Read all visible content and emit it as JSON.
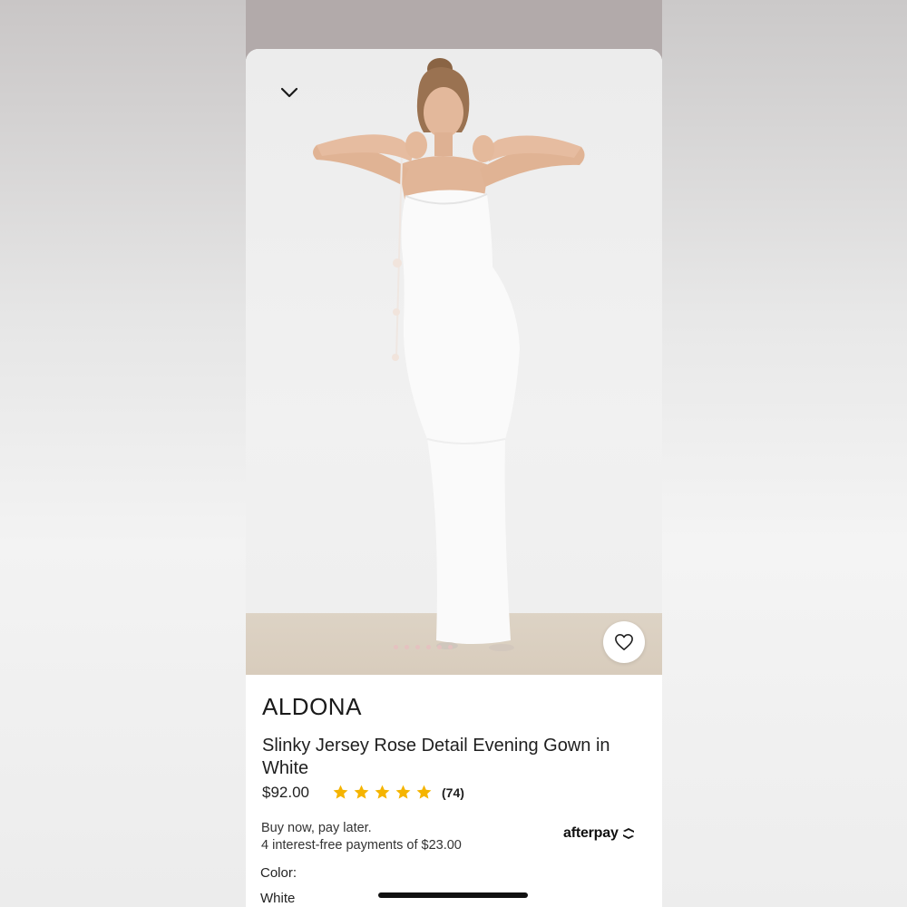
{
  "product": {
    "brand": "ALDONA",
    "name": "Slinky Jersey Rose Detail Evening Gown in White",
    "price": "$92.00",
    "rating": {
      "stars": 5,
      "count_label": "(74)",
      "star_color": "#f5b400"
    }
  },
  "payment": {
    "title": "Buy now, pay later.",
    "detail": "4 interest-free payments of $23.00",
    "provider": "afterpay"
  },
  "color": {
    "label": "Color:",
    "value": "White"
  },
  "gallery": {
    "image_count": 6,
    "active_index": 0
  },
  "icons": {
    "collapse": "chevron-down-icon",
    "favorite": "heart-outline-icon",
    "afterpay_logo": "afterpay-arrows-icon"
  },
  "colors": {
    "backdrop": "#b2aaaa",
    "sheet": "#ffffff",
    "text": "#1f1f1f"
  }
}
